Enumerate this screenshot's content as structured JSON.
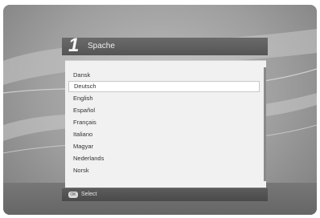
{
  "dialog": {
    "step_number": "1",
    "title": "Spache"
  },
  "languages": [
    "Dansk",
    "Deutsch",
    "English",
    "Español",
    "Français",
    "Italiano",
    "Magyar",
    "Nederlands",
    "Norsk"
  ],
  "selected_index": 1,
  "footer": {
    "ok_icon_text": "OK",
    "select_label": "Select"
  },
  "colors": {
    "title_bar": "#555555",
    "list_background": "#f1f1f1",
    "footer_bar": "#4a4a4a"
  },
  "icons": {
    "ok": "ok-button-icon"
  }
}
